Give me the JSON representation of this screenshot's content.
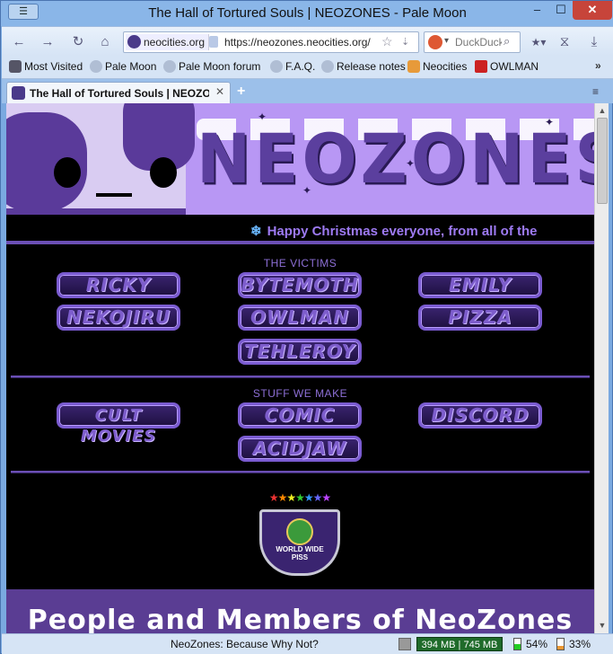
{
  "window": {
    "title": "The Hall of Tortured Souls | NEOZONES - Pale Moon",
    "menu_button": "☰",
    "minimize": "–",
    "maximize": "☐",
    "close": "✕"
  },
  "nav": {
    "back_icon": "←",
    "forward_icon": "→",
    "reload_icon": "↻",
    "home_icon": "⌂",
    "identity_label": "neocities.org",
    "url": "https://neozones.neocities.org/",
    "bookmark_star": "☆",
    "url_dropdown": "⇣",
    "search_engine_dropdown": "▾",
    "search_placeholder": "DuckDuckGo",
    "search_go": "⌕",
    "bookmarks_menu": "★▾",
    "history_icon": "⧖",
    "download_icon": "⤓"
  },
  "bookmarks": [
    {
      "label": "Most Visited",
      "icon": "gear-icon"
    },
    {
      "label": "Pale Moon",
      "icon": "globe-icon"
    },
    {
      "label": "Pale Moon forum",
      "icon": "globe-icon"
    },
    {
      "label": "F.A.Q.",
      "icon": "globe-icon"
    },
    {
      "label": "Release notes",
      "icon": "globe-icon"
    },
    {
      "label": "Neocities",
      "icon": "cat-icon"
    },
    {
      "label": "OWLMAN",
      "icon": "owl-icon"
    }
  ],
  "bookmarks_more": "»",
  "tab": {
    "label": "The Hall of Tortured Souls | NEOZONES",
    "close": "✕",
    "new_tab": "+",
    "list_icon": "≡"
  },
  "page": {
    "logo_text": "NEOZONES",
    "marquee_flake": "❄",
    "marquee_text": "Happy Christmas everyone, from all of the",
    "victims_title": "THE VICTIMS",
    "victims": [
      "RICKY",
      "BYTEMOTH",
      "EMILY",
      "NEKOJIRU",
      "OWLMAN",
      "PIZZA",
      "TEHLEROY"
    ],
    "stuff_title": "STUFF WE MAKE",
    "stuff": [
      "CULT MOVIES",
      "COMIC",
      "DISCORD",
      "ACIDJAW"
    ],
    "badge_stars": "★★★★★★★",
    "badge_text_1": "WORLD WIDE",
    "badge_text_2": "PISS",
    "members_title": "People and Members of NeoZones"
  },
  "scrollbar": {
    "up": "▲",
    "down": "▼"
  },
  "status": {
    "text": "NeoZones: Because Why Not?",
    "memory": "394 MB | 745 MB",
    "cpu1": "54%",
    "cpu2": "33%"
  },
  "colors": {
    "accent_purple": "#7d5dcc",
    "banner_purple": "#b897f4",
    "members_bg": "#5a3d93",
    "close_red": "#c7443a"
  }
}
